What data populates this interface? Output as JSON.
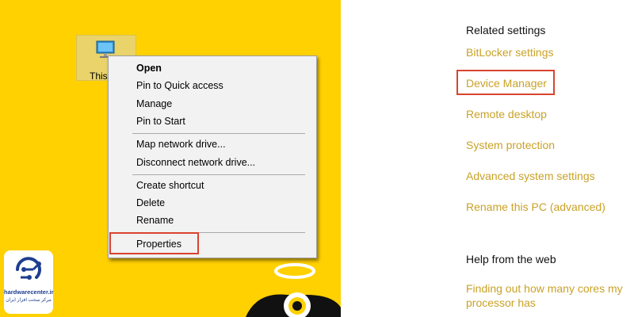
{
  "desktop": {
    "icon_label": "This PC",
    "icon_label_visible": "This"
  },
  "context_menu": {
    "items": [
      {
        "label": "Open"
      },
      {
        "label": "Pin to Quick access"
      },
      {
        "label": "Manage"
      },
      {
        "label": "Pin to Start"
      },
      {
        "label": "Map network drive..."
      },
      {
        "label": "Disconnect network drive..."
      },
      {
        "label": "Create shortcut"
      },
      {
        "label": "Delete"
      },
      {
        "label": "Rename"
      },
      {
        "label": "Properties"
      }
    ]
  },
  "logo": {
    "text": "hardwarecenter.ir",
    "subtext": "مرکز سخت افزار ایران"
  },
  "settings": {
    "related_heading": "Related settings",
    "related_links": [
      "BitLocker settings",
      "Device Manager",
      "Remote desktop",
      "System protection",
      "Advanced system settings",
      "Rename this PC (advanced)"
    ],
    "help_heading": "Help from the web",
    "help_link_line1": "Finding out how many cores my",
    "help_link_line2": "processor has"
  },
  "colors": {
    "desktop_background": "#FFD100",
    "link": "#C9A227",
    "highlight_border": "#D9432F",
    "menu_background": "#F2F2F2",
    "logo_blue": "#1d3d8f"
  }
}
